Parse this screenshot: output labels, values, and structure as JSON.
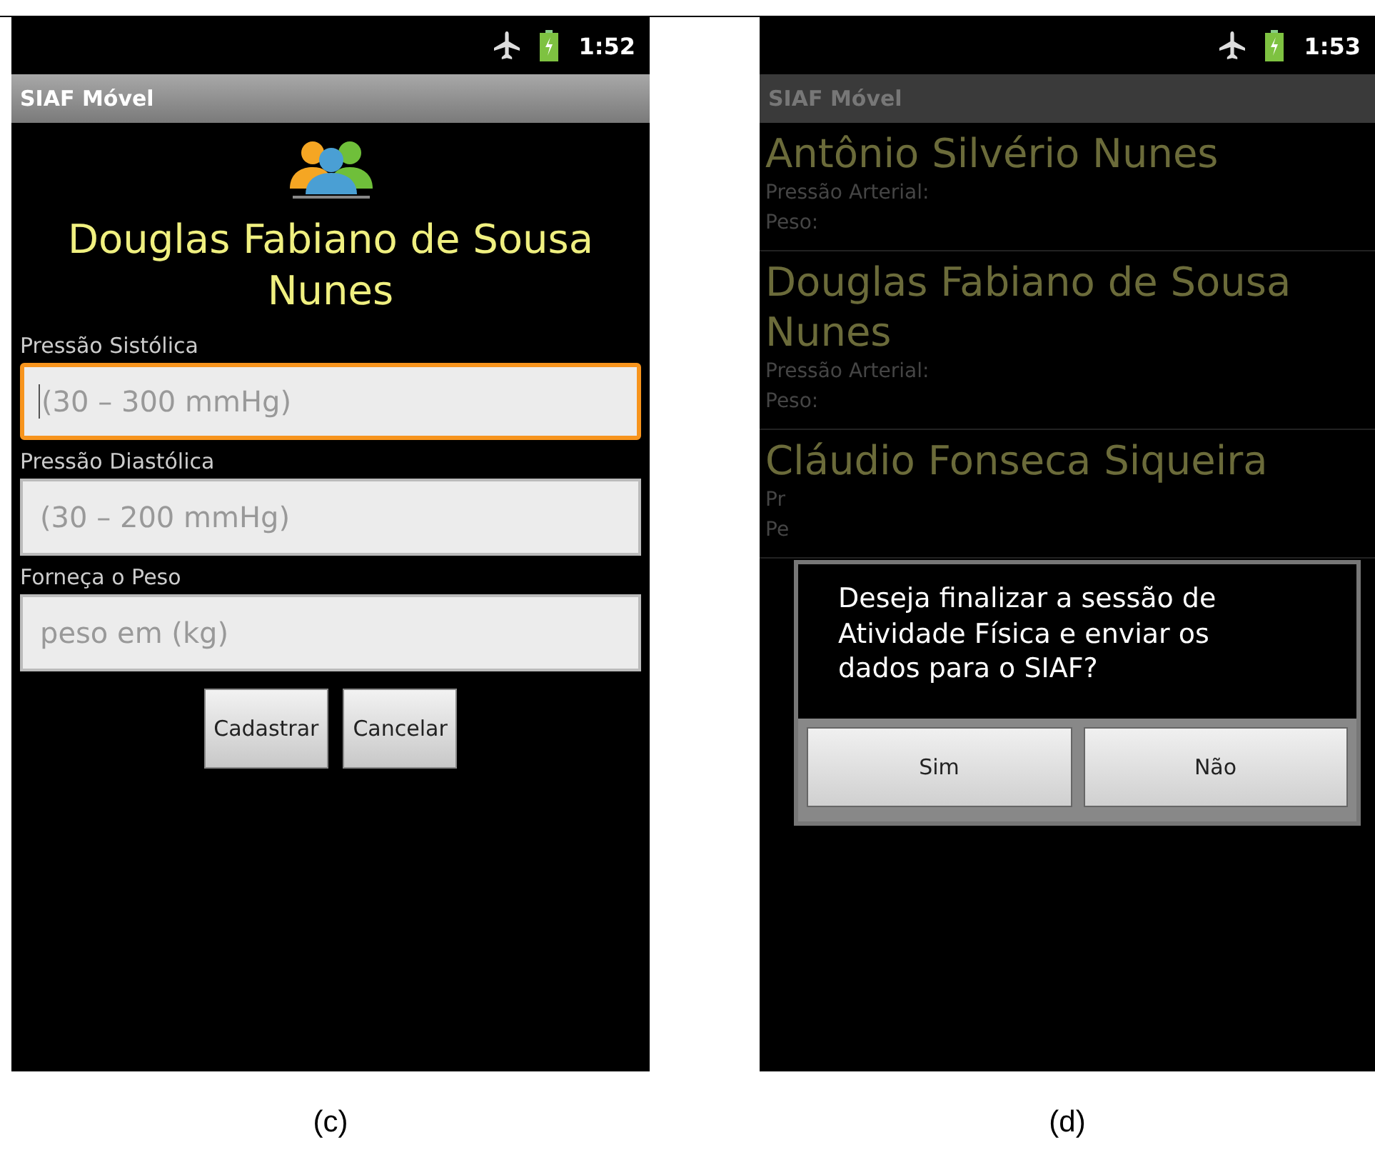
{
  "panels": [
    {
      "kind": "form",
      "caption": "(c)",
      "status_bar": {
        "time": "1:52"
      },
      "app_title": "SIAF Móvel",
      "patient_name": "Douglas Fabiano de Sousa Nunes",
      "fields": [
        {
          "label": "Pressão Sistólica",
          "placeholder": "(30 – 300 mmHg)",
          "focused": true
        },
        {
          "label": "Pressão Diastólica",
          "placeholder": "(30 – 200 mmHg)",
          "focused": false
        },
        {
          "label": "Forneça o Peso",
          "placeholder": "peso em (kg)",
          "focused": false
        }
      ],
      "buttons": [
        "Cadastrar",
        "Cancelar"
      ]
    },
    {
      "kind": "list",
      "caption": "(d)",
      "status_bar": {
        "time": "1:53"
      },
      "app_title": "SIAF Móvel",
      "patients": [
        {
          "name": "Antônio Silvério Nunes",
          "fields": [
            "Pressão Arterial:",
            "Peso:"
          ]
        },
        {
          "name": "Douglas Fabiano de Sousa Nunes",
          "fields": [
            "Pressão Arterial:",
            "Peso:"
          ]
        },
        {
          "name": "Cláudio Fonseca Siqueira",
          "fields": [
            "Pr",
            "Pe"
          ]
        }
      ],
      "dialog": {
        "message": "Deseja finalizar a sessão de Atividade Física e enviar os dados para o SIAF?",
        "buttons": [
          "Sim",
          "Não"
        ]
      }
    }
  ]
}
